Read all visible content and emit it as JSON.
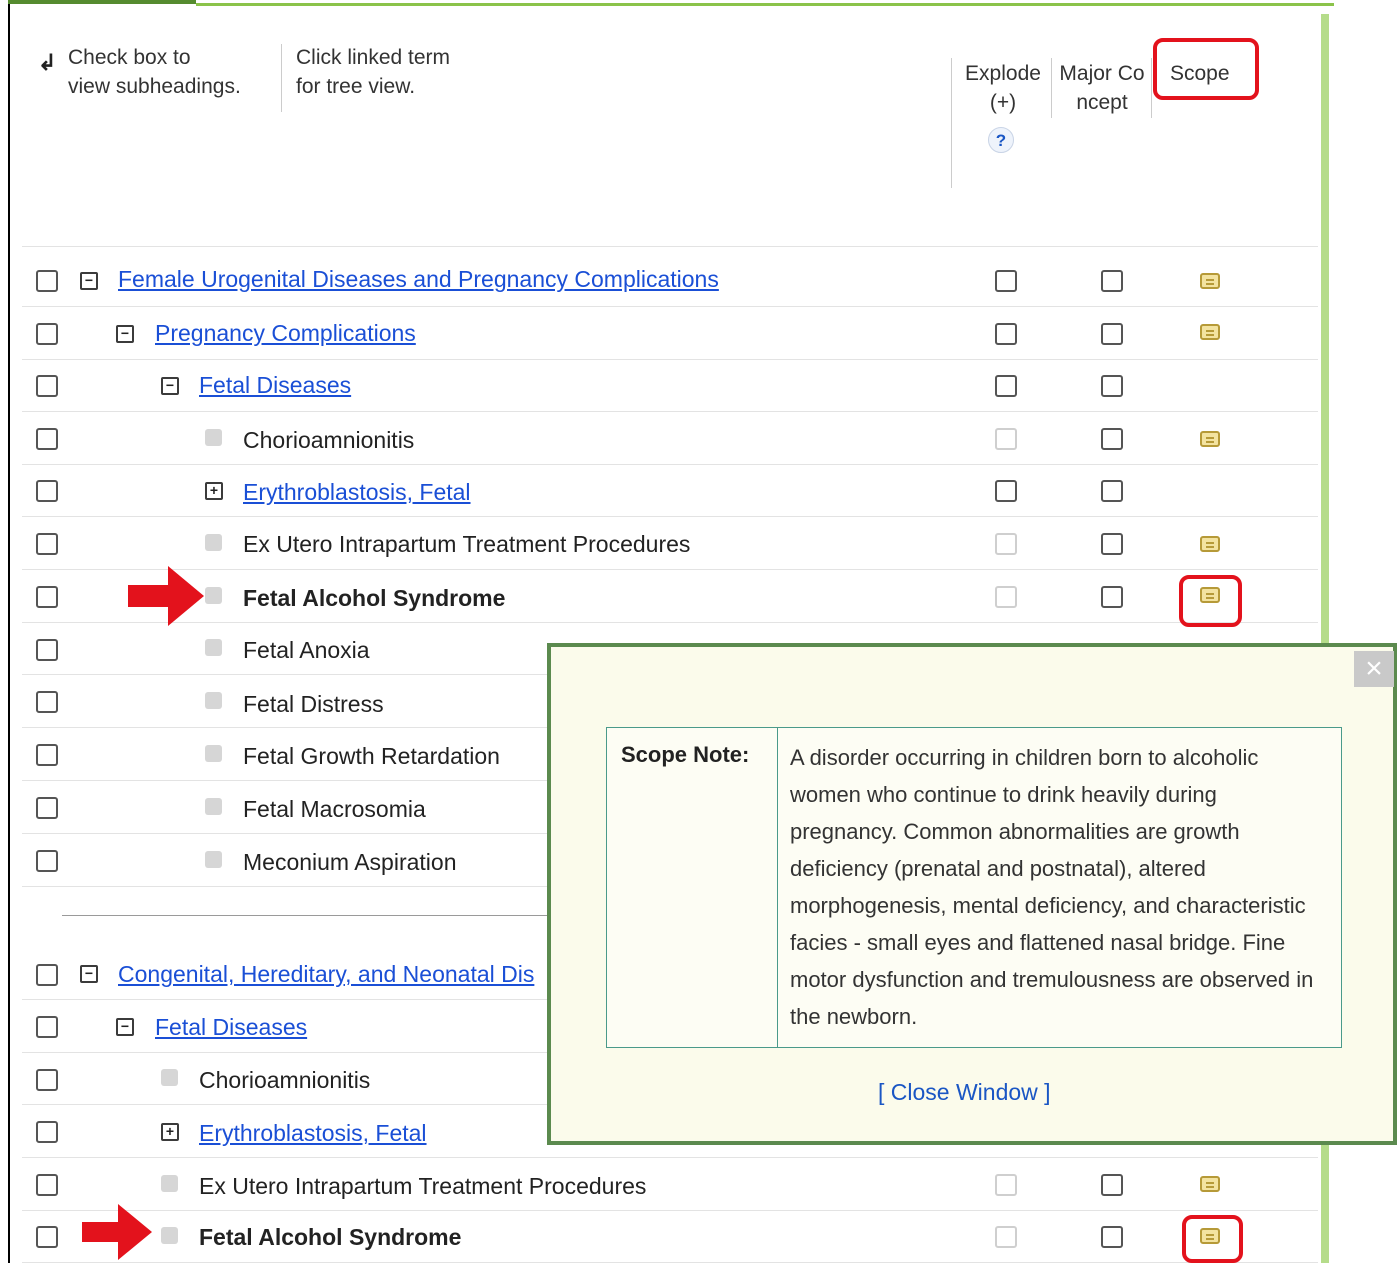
{
  "header": {
    "instruction_checkbox": "Check box to view subheadings.",
    "instruction_checkbox_line1": "Check box to",
    "instruction_checkbox_line2": "view subheadings.",
    "instruction_link_line1": "Click linked term",
    "instruction_link_line2": "for tree view.",
    "col_explode_line1": "Explode",
    "col_explode_line2": "(+)",
    "col_help": "?",
    "col_major_line1": "Major Co",
    "col_major_line2": "ncept",
    "col_scope": "Scope"
  },
  "tree1": [
    {
      "label": "Female Urogenital Diseases and Pregnancy Complications",
      "type": "link",
      "toggle": "−"
    },
    {
      "label": "Pregnancy Complications",
      "type": "link",
      "toggle": "−"
    },
    {
      "label": "Fetal Diseases",
      "type": "link",
      "toggle": "−"
    },
    {
      "label": "Chorioamnionitis",
      "type": "leaf"
    },
    {
      "label": "Erythroblastosis, Fetal",
      "type": "link",
      "toggle": "+"
    },
    {
      "label": "Ex Utero Intrapartum Treatment Procedures",
      "type": "leaf"
    },
    {
      "label": "Fetal Alcohol Syndrome",
      "type": "bold"
    },
    {
      "label": "Fetal Anoxia",
      "type": "leaf"
    },
    {
      "label": "Fetal Distress",
      "type": "leaf"
    },
    {
      "label": "Fetal Growth Retardation",
      "type": "leaf"
    },
    {
      "label": "Fetal Macrosomia",
      "type": "leaf"
    },
    {
      "label": "Meconium Aspiration",
      "type": "leaf"
    }
  ],
  "tree2": [
    {
      "label": "Congenital, Hereditary, and Neonatal Dis",
      "type": "link",
      "toggle": "−"
    },
    {
      "label": "Fetal Diseases",
      "type": "link",
      "toggle": "−"
    },
    {
      "label": "Chorioamnionitis",
      "type": "leaf"
    },
    {
      "label": "Erythroblastosis, Fetal",
      "type": "link",
      "toggle": "+"
    },
    {
      "label": "Ex Utero Intrapartum Treatment Procedures",
      "type": "leaf"
    },
    {
      "label": "Fetal Alcohol Syndrome",
      "type": "bold"
    }
  ],
  "popup": {
    "close_symbol": "×",
    "scope_label": "Scope Note:",
    "scope_text": "A disorder occurring in children born to alcoholic women who continue to drink heavily during pregnancy. Common abnormalities are growth deficiency (prenatal and postnatal), altered morphogenesis, mental deficiency, and characteristic facies - small eyes and flattened nasal bridge. Fine motor dysfunction and tremulousness are observed in the newborn.",
    "close_link": "[ Close Window ]"
  },
  "colors": {
    "link": "#1a4fd6",
    "highlight_red": "#e3121c",
    "popup_border": "#5b8a4e",
    "popup_bg": "#fbfbeb",
    "accent_green": "#8bc34a"
  }
}
